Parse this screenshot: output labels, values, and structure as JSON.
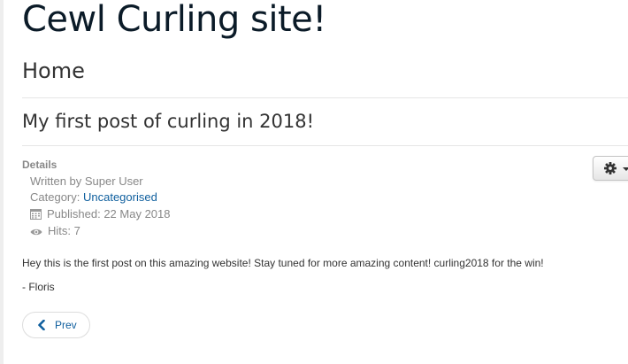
{
  "site": {
    "title": "Cewl Curling site!"
  },
  "page": {
    "heading": "Home"
  },
  "article": {
    "title": "My first post of curling in 2018!",
    "details_label": "Details",
    "author_text": "Written by Super User",
    "category_prefix": "Category: ",
    "category_link": "Uncategorised",
    "published_text": "Published: 22 May 2018",
    "hits_text": "Hits: 7",
    "body": "Hey this is the first post on this amazing website! Stay tuned for more amazing content! curling2018 for the win!",
    "signature": "- Floris"
  },
  "tools": {
    "icon": "gear-icon"
  },
  "pagination": {
    "prev_label": "Prev",
    "prev_icon": "chevron-left-icon"
  },
  "colors": {
    "link": "#0f5f9e",
    "title": "#0b1b28",
    "muted": "#888888"
  }
}
